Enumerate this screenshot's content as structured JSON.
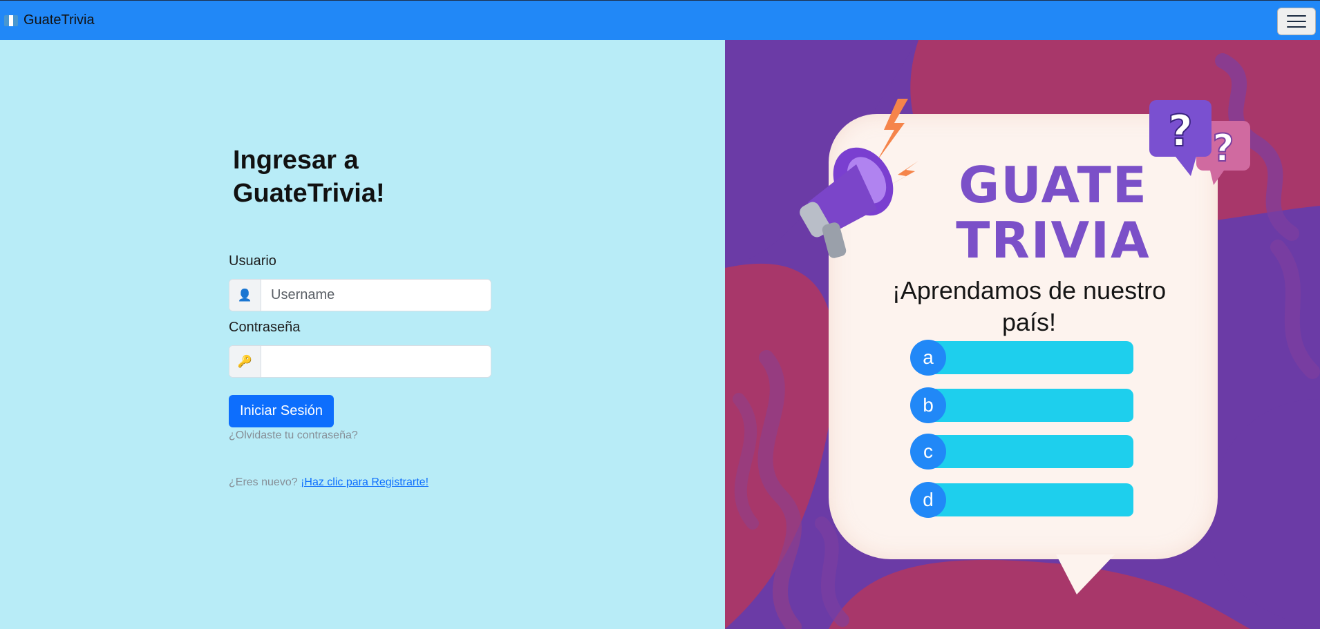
{
  "navbar": {
    "brand": "GuateTrivia",
    "flag_colors": [
      "#4997d0",
      "#ffffff",
      "#4997d0"
    ]
  },
  "login": {
    "title": "Ingresar a GuateTrivia!",
    "username_label": "Usuario",
    "username_placeholder": "Username",
    "username_icon": "user-icon",
    "password_label": "Contraseña",
    "password_icon": "key-icon",
    "submit_label": "Iniciar Sesión",
    "forgot_text": "¿Olvidaste tu contraseña?",
    "register_prompt": "¿Eres nuevo?",
    "register_link": "¡Haz clic para Registrarte!"
  },
  "promo": {
    "logo_line1": "GUATE",
    "logo_line2": "TRIVIA",
    "tagline": "¡Aprendamos de nuestro país!",
    "options": [
      "a",
      "b",
      "c",
      "d"
    ]
  },
  "colors": {
    "navbar": "#2188f7",
    "left_bg": "#b8ecf7",
    "primary": "#0d6efd",
    "purple": "#6b3ba6",
    "magenta": "#a8376a",
    "option_bar": "#1ecfed"
  }
}
